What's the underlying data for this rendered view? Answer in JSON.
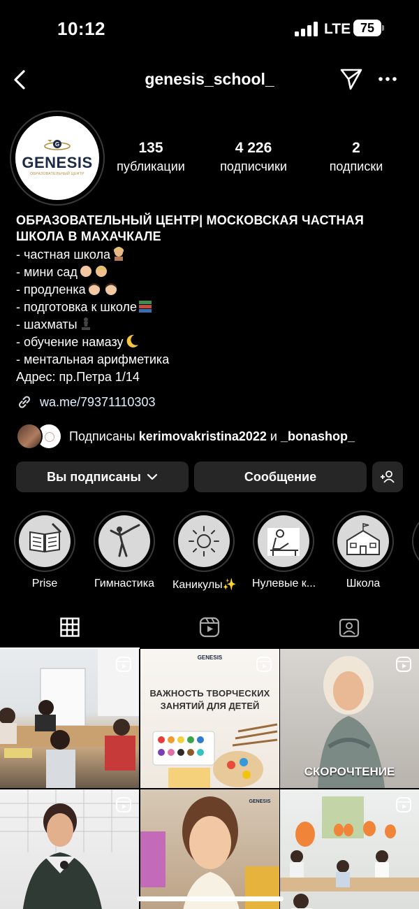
{
  "status_bar": {
    "time": "10:12",
    "network": "LTE",
    "battery": "75"
  },
  "nav": {
    "title": "genesis_school_"
  },
  "profile": {
    "avatar": {
      "logo_text": "GENESIS",
      "logo_sub": "ОБРАЗОВАТЕЛЬНЫЙ ЦЕНТР"
    },
    "stats": [
      {
        "num": "135",
        "label": "публикации"
      },
      {
        "num": "4 226",
        "label": "подписчики"
      },
      {
        "num": "2",
        "label": "подписки"
      }
    ]
  },
  "bio": {
    "name_line1": "ОБРАЗОВАТЕЛЬНЫЙ ЦЕНТР| МОСКОВСКАЯ ЧАСТНАЯ",
    "name_line2": "ШКОЛА В МАХАЧКАЛЕ",
    "lines": [
      "- частная школа",
      "- мини сад",
      "- продленка",
      "- подготовка к школе",
      "- шахматы",
      "- обучение намазу",
      "- ментальная арифметика",
      "Адрес: пр.Петра 1/14"
    ],
    "link": "wa.me/79371110303"
  },
  "followed_by": {
    "prefix": "Подписаны",
    "user1": "kerimovakristina2022",
    "conj": "и",
    "user2": "_bonashop_"
  },
  "buttons": {
    "following": "Вы подписаны",
    "message": "Сообщение"
  },
  "highlights": [
    {
      "label": "Prise",
      "icon": "book-icon"
    },
    {
      "label": "Гимнастика",
      "icon": "gymnast-icon"
    },
    {
      "label": "Каникулы✨",
      "icon": "sun-icon"
    },
    {
      "label": "Нулевые к...",
      "icon": "student-desk-icon"
    },
    {
      "label": "Школа",
      "icon": "school-building-icon"
    }
  ],
  "posts": [
    {
      "caption": ""
    },
    {
      "caption_line1": "ВАЖНОСТЬ ТВОРЧЕСКИХ",
      "caption_line2": "ЗАНЯТИЙ ДЛЯ ДЕТЕЙ",
      "brand": "GENESIS"
    },
    {
      "caption": "СКОРОЧТЕНИЕ"
    },
    {
      "caption": ""
    },
    {
      "brand": "GENESIS"
    },
    {
      "caption": ""
    }
  ]
}
